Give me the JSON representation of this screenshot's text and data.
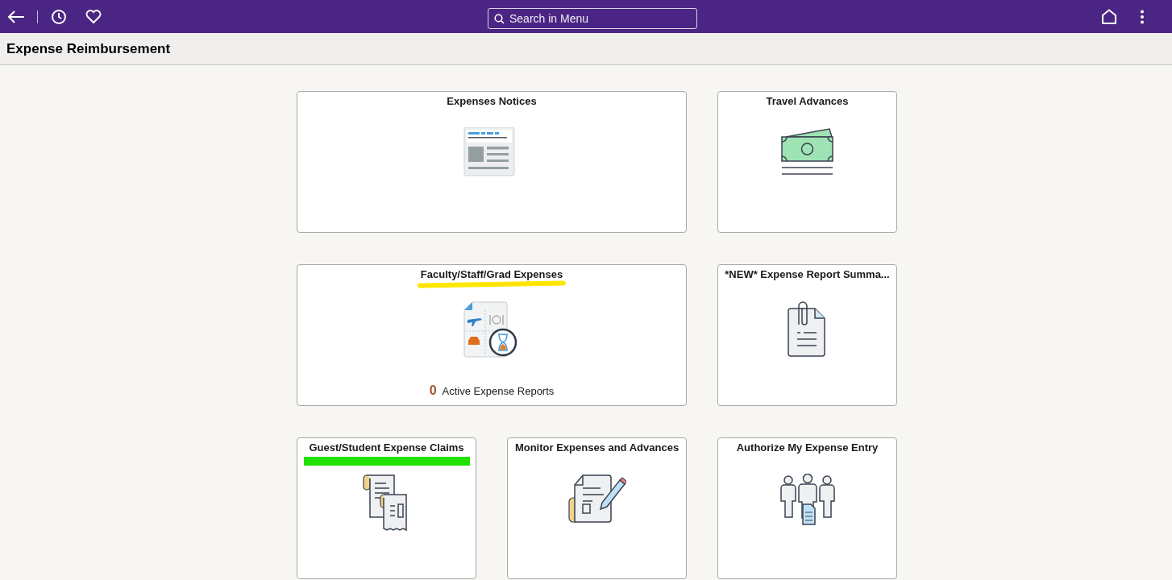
{
  "top_bar": {
    "search": {
      "placeholder": "Search in Menu"
    }
  },
  "page_title": "Expense Reimbursement",
  "tiles": [
    {
      "title": "Expenses Notices",
      "kind": "large"
    },
    {
      "title": "Travel Advances",
      "kind": "small"
    },
    {
      "title": "Faculty/Staff/Grad Expenses",
      "kind": "large",
      "highlight": {
        "kind": "underline",
        "color": "#ffe600"
      },
      "count": "0",
      "count_label": "Active Expense Reports"
    },
    {
      "title": "*NEW* Expense Report Summa...",
      "kind": "small"
    },
    {
      "title": "Guest/Student Expense Claims",
      "kind": "small",
      "highlight": {
        "kind": "bar",
        "color": "#22e000"
      }
    },
    {
      "title": "Monitor Expenses and Advances",
      "kind": "small"
    },
    {
      "title": "Authorize My Expense Entry",
      "kind": "small"
    }
  ]
}
